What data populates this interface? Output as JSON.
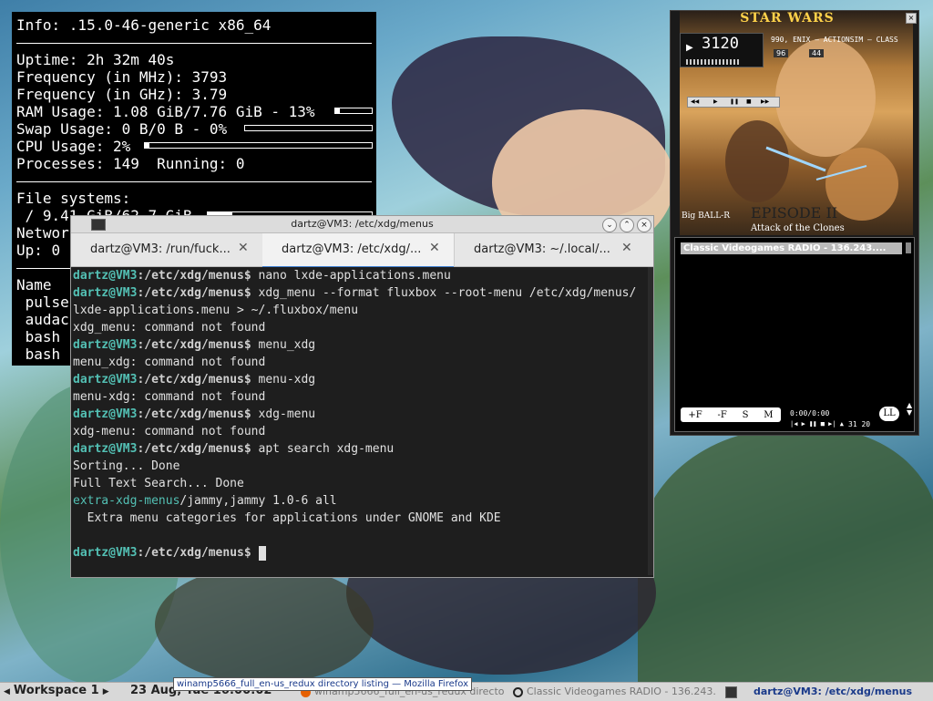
{
  "conky": {
    "info": "Info: .15.0-46-generic x86_64",
    "uptime": "Uptime: 2h 32m 40s",
    "freq_mhz": "Frequency (in MHz): 3793",
    "freq_ghz": "Frequency (in GHz): 3.79",
    "ram": "RAM Usage: 1.08 GiB/7.76 GiB - 13%",
    "ram_fraction": 0.13,
    "swap": "Swap Usage: 0 B/0 B - 0%",
    "swap_fraction": 0.0,
    "cpu": "CPU Usage: 2%",
    "cpu_fraction": 0.02,
    "processes": "Processes: 149  Running: 0",
    "fs_header": "File systems:",
    "fs_root": " / 9.41 GiB/62.7 GiB",
    "fs_fraction": 0.15,
    "network": "Networ",
    "up": "Up: 0",
    "name_header": "Name",
    "procs": [
      " pulse",
      " audac",
      " bash",
      " bash"
    ]
  },
  "winamp": {
    "logo": "STAR WARS",
    "time": "3120",
    "ticker": "990, ENIX — ACTIONSIM — CLASS",
    "kbps": "96",
    "khz": "44",
    "episode": "EPISODE II",
    "subtitle": "Attack of the Clones",
    "credit": "Big BALL-R",
    "close": "×",
    "playlist": {
      "item": "Classic Videogames RADIO - 136.243....",
      "buttons": [
        "+F",
        "-F",
        "S",
        "M"
      ],
      "time": "0:00/0:00",
      "mini_controls": "|◀ ▶ ❚❚ ■ ▶| ▲",
      "mini_time": "31 20",
      "ll": "LL"
    }
  },
  "terminal": {
    "title": "dartz@VM3: /etc/xdg/menus",
    "tabs": [
      {
        "label": "dartz@VM3: /run/fuck..."
      },
      {
        "label": "dartz@VM3: /etc/xdg/..."
      },
      {
        "label": "dartz@VM3: ~/.local/..."
      }
    ],
    "prompt_user": "dartz@VM3",
    "prompt_path": ":/etc/xdg/menus",
    "prompt_sign": "$ ",
    "lines": [
      {
        "cmd": "nano lxde-applications.menu"
      },
      {
        "cmd": "xdg_menu --format fluxbox --root-menu /etc/xdg/menus/"
      },
      {
        "text": "lxde-applications.menu > ~/.fluxbox/menu"
      },
      {
        "text": "xdg_menu: command not found"
      },
      {
        "cmd": "menu_xdg"
      },
      {
        "text": "menu_xdg: command not found"
      },
      {
        "cmd": "menu-xdg"
      },
      {
        "text": "menu-xdg: command not found"
      },
      {
        "cmd": "xdg-menu"
      },
      {
        "text": "xdg-menu: command not found"
      },
      {
        "cmd": "apt search xdg-menu"
      },
      {
        "text": "Sorting... Done"
      },
      {
        "text": "Full Text Search... Done"
      },
      {
        "pkg": "extra-xdg-menus",
        "rest": "/jammy,jammy 1.0-6 all"
      },
      {
        "text": "  Extra menu categories for applications under GNOME and KDE"
      },
      {
        "text": ""
      },
      {
        "cmd": "",
        "cursor": true
      }
    ],
    "window_buttons": [
      "⌄",
      "⌃",
      "×"
    ]
  },
  "taskbar": {
    "workspace": "Workspace 1",
    "date": "23 Aug, Tue 16:00:02",
    "tooltip": "winamp5666_full_en-us_redux directory listing — Mozilla Firefox",
    "tasks": [
      "winamp5666_full_en-us_redux directo",
      "Classic Videogames RADIO - 136.243.",
      "dartz@VM3: /etc/xdg/menus"
    ]
  }
}
